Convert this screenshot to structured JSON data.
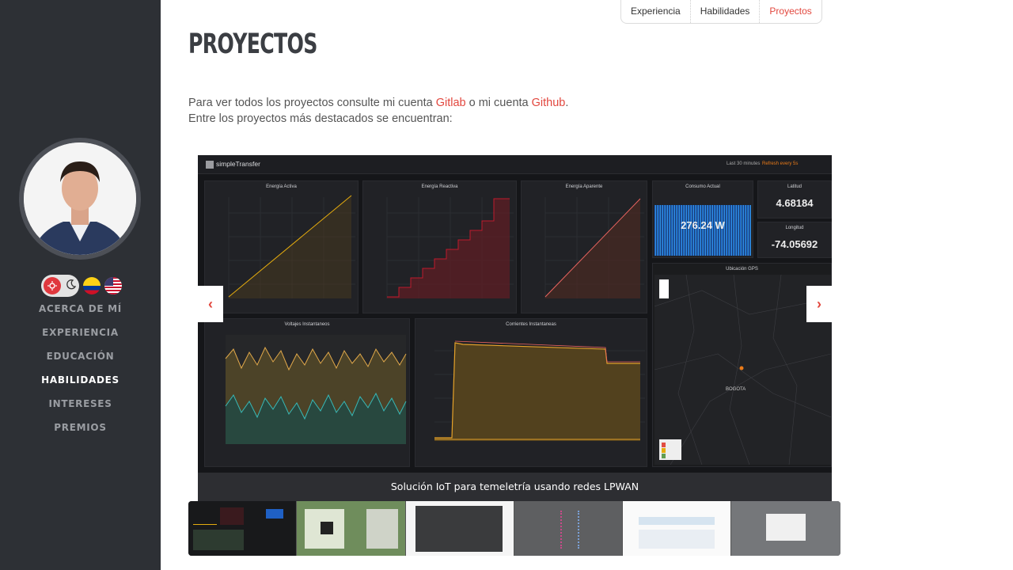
{
  "sidebar": {
    "toggles": {
      "theme_light": "sun-icon",
      "theme_dark": "moon-icon",
      "lang_es": "colombia-flag-icon",
      "lang_en": "usa-flag-icon"
    },
    "nav": [
      "ACERCA DE MÍ",
      "EXPERIENCIA",
      "EDUCACIÓN",
      "HABILIDADES",
      "INTERESES",
      "PREMIOS"
    ],
    "active_nav": "HABILIDADES"
  },
  "tabs": [
    "Experiencia",
    "Habilidades",
    "Proyectos"
  ],
  "main": {
    "title": "PROYECTOS",
    "intro_1_pre": "Para ver todos los proyectos consulte mi cuenta ",
    "gitlab": "Gitlab",
    "intro_1_mid": " o mi cuenta ",
    "github": "Github",
    "intro_1_end": ".",
    "intro_2": "Entre los proyectos más destacados se encuentran:"
  },
  "carousel": {
    "caption": "Solución IoT para temeletría usando redes LPWAN",
    "prev": "‹",
    "next": "›",
    "dashboard": {
      "app_name": "simpleTransfer",
      "time_range": "Last 30 minutes",
      "refresh": "Refresh every 5s",
      "panels": {
        "energia_activa": "Energía Activa",
        "energia_reactiva": "Energía Reactiva",
        "energia_aparente": "Energía Aparente",
        "consumo": "Consumo Actual",
        "consumo_value": "276.24 W",
        "latitud": "Latitud",
        "latitud_value": "4.68184",
        "longitud": "Longitud",
        "longitud_value": "-74.05692",
        "voltajes": "Voltajes Instantaneos",
        "corrientes": "Corrientes Instantaneas",
        "gps": "Ubicación GPS",
        "map_city": "BOGOTA"
      }
    }
  }
}
